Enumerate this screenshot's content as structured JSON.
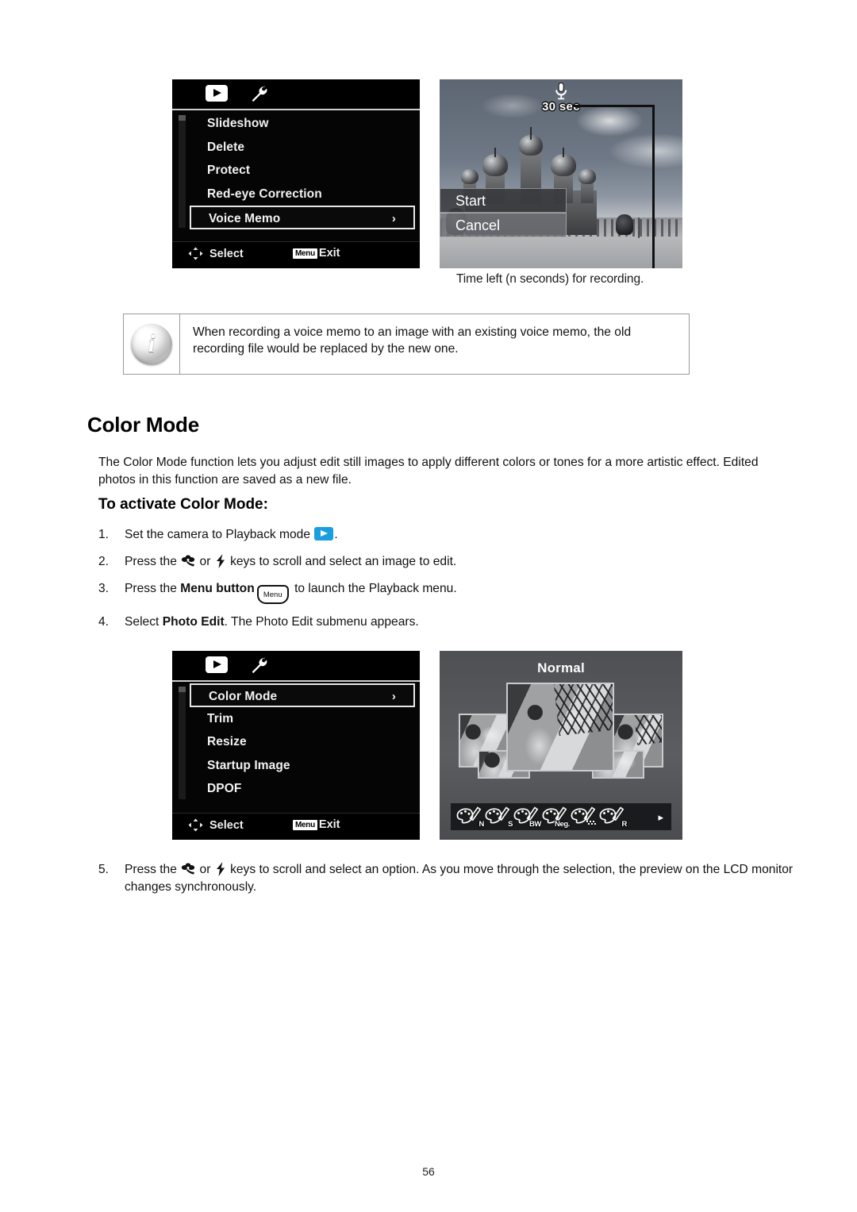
{
  "page_number": "56",
  "voice_memo_menu": {
    "tabs": [
      {
        "icon": "playback-icon",
        "selected": true
      },
      {
        "icon": "wrench-icon",
        "selected": false
      }
    ],
    "items": [
      {
        "label": "Slideshow",
        "selected": false,
        "chevron": ""
      },
      {
        "label": "Delete",
        "selected": false,
        "chevron": ""
      },
      {
        "label": "Protect",
        "selected": false,
        "chevron": ""
      },
      {
        "label": "Red-eye Correction",
        "selected": false,
        "chevron": ""
      },
      {
        "label": "Voice Memo",
        "selected": true,
        "chevron": "›"
      }
    ],
    "footer": {
      "select_label": "Select",
      "menu_badge": "Menu",
      "exit_label": "Exit"
    }
  },
  "voice_memo_preview": {
    "time_label": "30 sec",
    "mic_icon": "microphone-icon",
    "options": [
      {
        "label": "Start",
        "selected": true
      },
      {
        "label": "Cancel",
        "selected": false
      }
    ],
    "caption": "Time left (n seconds) for recording."
  },
  "note": {
    "icon": "info-icon",
    "icon_letter": "i",
    "text": "When recording a voice memo to an image with an existing voice memo, the old recording file would be replaced by the new one."
  },
  "section": {
    "title": "Color Mode",
    "paragraph": "The Color Mode function lets you adjust edit still images to apply different colors or tones for a more artistic effect. Edited photos in this function are saved as a new file.",
    "subtitle": "To activate Color Mode:"
  },
  "steps": [
    {
      "num": "1.",
      "parts": [
        {
          "type": "text",
          "value": "Set the camera to Playback mode "
        },
        {
          "type": "icon",
          "value": "playback-mode-icon"
        },
        {
          "type": "text",
          "value": "."
        }
      ]
    },
    {
      "num": "2.",
      "parts": [
        {
          "type": "text",
          "value": "Press the "
        },
        {
          "type": "icon",
          "value": "macro-icon"
        },
        {
          "type": "text",
          "value": " or "
        },
        {
          "type": "icon",
          "value": "flash-icon"
        },
        {
          "type": "text",
          "value": " keys to scroll and select an image to edit."
        }
      ]
    },
    {
      "num": "3.",
      "parts": [
        {
          "type": "text",
          "value": "Press the "
        },
        {
          "type": "bold",
          "value": "Menu button"
        },
        {
          "type": "icon",
          "value": "menu-button-icon"
        },
        {
          "type": "text",
          "value": " to launch the Playback menu."
        }
      ]
    },
    {
      "num": "4.",
      "parts": [
        {
          "type": "text",
          "value": "Select "
        },
        {
          "type": "bold",
          "value": "Photo Edit"
        },
        {
          "type": "text",
          "value": ". The Photo Edit submenu appears."
        }
      ]
    },
    {
      "num": "5.",
      "parts": [
        {
          "type": "text",
          "value": "Press the "
        },
        {
          "type": "icon",
          "value": "macro-icon"
        },
        {
          "type": "text",
          "value": " or "
        },
        {
          "type": "icon",
          "value": "flash-icon"
        },
        {
          "type": "text",
          "value": " keys to scroll and select an option. As you move through the selection, the preview on the LCD monitor changes synchronously."
        }
      ]
    }
  ],
  "photo_edit_menu": {
    "tabs": [
      {
        "icon": "playback-icon",
        "selected": true
      },
      {
        "icon": "wrench-icon",
        "selected": false
      }
    ],
    "items": [
      {
        "label": "Color Mode",
        "selected": true,
        "chevron": "›"
      },
      {
        "label": "Trim",
        "selected": false,
        "chevron": ""
      },
      {
        "label": "Resize",
        "selected": false,
        "chevron": ""
      },
      {
        "label": "Startup Image",
        "selected": false,
        "chevron": ""
      },
      {
        "label": "DPOF",
        "selected": false,
        "chevron": ""
      }
    ],
    "footer": {
      "select_label": "Select",
      "menu_badge": "Menu",
      "exit_label": "Exit"
    }
  },
  "color_mode_preview": {
    "title": "Normal",
    "modes": [
      {
        "label": "N",
        "name": "normal"
      },
      {
        "label": "S",
        "name": "sepia"
      },
      {
        "label": "BW",
        "name": "black-and-white"
      },
      {
        "label": "Neg.",
        "name": "negative"
      },
      {
        "label": "",
        "name": "mosaic"
      },
      {
        "label": "R",
        "name": "red"
      }
    ],
    "next_arrow": "▸"
  },
  "colors": {
    "playback_accent": "#1a9ee0",
    "lcd_background": "#000000",
    "highlight_border": "#e8e8e8"
  }
}
